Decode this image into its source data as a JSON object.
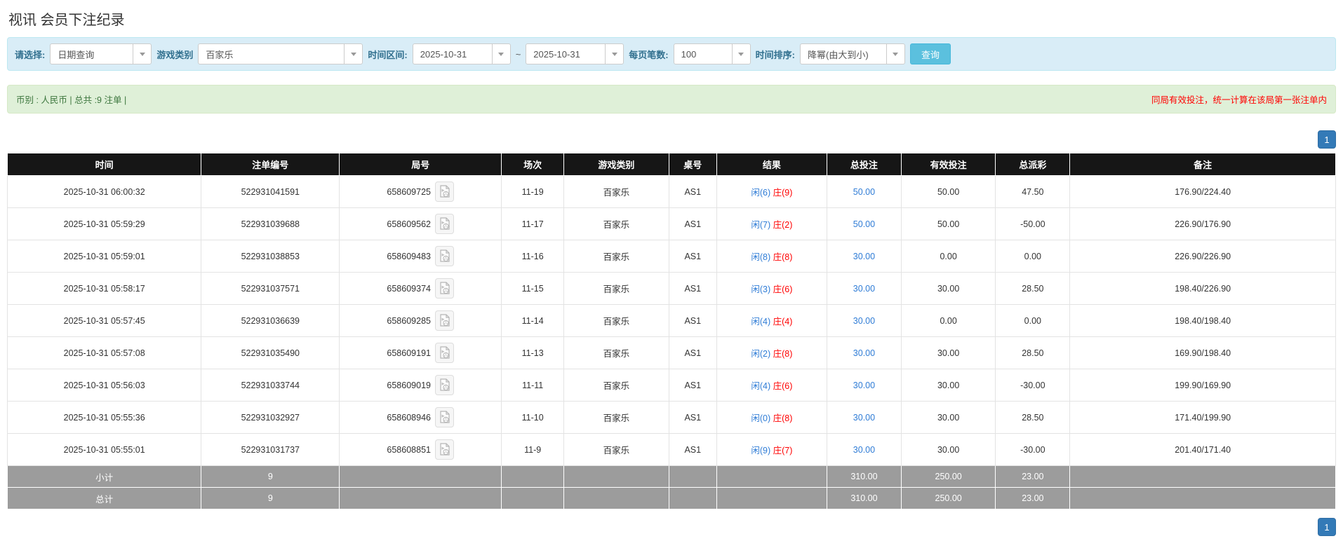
{
  "page": {
    "title": "视讯 会员下注纪录"
  },
  "colors": {
    "link_blue": "#2f7cd6",
    "banker_red": "#ff0000",
    "header_bg": "#161616",
    "summary_bg": "#9c9c9c",
    "pagination_blue": "#337ab7",
    "filter_bg": "#d9edf7",
    "info_bg": "#dff0d8",
    "search_btn": "#5bc0de"
  },
  "filters": {
    "select_label": "请选择:",
    "select_value": "日期查询",
    "game_type_label": "游戏类别",
    "game_type_value": "百家乐",
    "date_range_label": "时间区间:",
    "date_from": "2025-10-31",
    "date_separator": "~",
    "date_to": "2025-10-31",
    "page_size_label": "每页笔数:",
    "page_size_value": "100",
    "sort_label": "时间排序:",
    "sort_value": "降幂(由大到小)",
    "search_button": "查询"
  },
  "info_bar": {
    "left_text": "币别 : 人民币 | 总共 :9 注单 |",
    "right_notice": "同局有效投注，统一计算在该局第一张注单内"
  },
  "pagination": {
    "page": "1"
  },
  "table": {
    "columns": [
      "时间",
      "注单编号",
      "局号",
      "场次",
      "游戏类别",
      "桌号",
      "结果",
      "总投注",
      "有效投注",
      "总派彩",
      "备注"
    ],
    "rows": [
      {
        "time": "2025-10-31 06:00:32",
        "bet_id": "522931041591",
        "round_id": "658609725",
        "session": "11-19",
        "game": "百家乐",
        "table": "AS1",
        "player": "闲(6)",
        "banker": "庄(9)",
        "total_bet": "50.00",
        "valid_bet": "50.00",
        "payout": "47.50",
        "remark": "176.90/224.40"
      },
      {
        "time": "2025-10-31 05:59:29",
        "bet_id": "522931039688",
        "round_id": "658609562",
        "session": "11-17",
        "game": "百家乐",
        "table": "AS1",
        "player": "闲(7)",
        "banker": "庄(2)",
        "total_bet": "50.00",
        "valid_bet": "50.00",
        "payout": "-50.00",
        "remark": "226.90/176.90"
      },
      {
        "time": "2025-10-31 05:59:01",
        "bet_id": "522931038853",
        "round_id": "658609483",
        "session": "11-16",
        "game": "百家乐",
        "table": "AS1",
        "player": "闲(8)",
        "banker": "庄(8)",
        "total_bet": "30.00",
        "valid_bet": "0.00",
        "payout": "0.00",
        "remark": "226.90/226.90"
      },
      {
        "time": "2025-10-31 05:58:17",
        "bet_id": "522931037571",
        "round_id": "658609374",
        "session": "11-15",
        "game": "百家乐",
        "table": "AS1",
        "player": "闲(3)",
        "banker": "庄(6)",
        "total_bet": "30.00",
        "valid_bet": "30.00",
        "payout": "28.50",
        "remark": "198.40/226.90"
      },
      {
        "time": "2025-10-31 05:57:45",
        "bet_id": "522931036639",
        "round_id": "658609285",
        "session": "11-14",
        "game": "百家乐",
        "table": "AS1",
        "player": "闲(4)",
        "banker": "庄(4)",
        "total_bet": "30.00",
        "valid_bet": "0.00",
        "payout": "0.00",
        "remark": "198.40/198.40"
      },
      {
        "time": "2025-10-31 05:57:08",
        "bet_id": "522931035490",
        "round_id": "658609191",
        "session": "11-13",
        "game": "百家乐",
        "table": "AS1",
        "player": "闲(2)",
        "banker": "庄(8)",
        "total_bet": "30.00",
        "valid_bet": "30.00",
        "payout": "28.50",
        "remark": "169.90/198.40"
      },
      {
        "time": "2025-10-31 05:56:03",
        "bet_id": "522931033744",
        "round_id": "658609019",
        "session": "11-11",
        "game": "百家乐",
        "table": "AS1",
        "player": "闲(4)",
        "banker": "庄(6)",
        "total_bet": "30.00",
        "valid_bet": "30.00",
        "payout": "-30.00",
        "remark": "199.90/169.90"
      },
      {
        "time": "2025-10-31 05:55:36",
        "bet_id": "522931032927",
        "round_id": "658608946",
        "session": "11-10",
        "game": "百家乐",
        "table": "AS1",
        "player": "闲(0)",
        "banker": "庄(8)",
        "total_bet": "30.00",
        "valid_bet": "30.00",
        "payout": "28.50",
        "remark": "171.40/199.90"
      },
      {
        "time": "2025-10-31 05:55:01",
        "bet_id": "522931031737",
        "round_id": "658608851",
        "session": "11-9",
        "game": "百家乐",
        "table": "AS1",
        "player": "闲(9)",
        "banker": "庄(7)",
        "total_bet": "30.00",
        "valid_bet": "30.00",
        "payout": "-30.00",
        "remark": "201.40/171.40"
      }
    ],
    "subtotal": {
      "label": "小计",
      "count": "9",
      "total_bet": "310.00",
      "valid_bet": "250.00",
      "payout": "23.00"
    },
    "total": {
      "label": "总计",
      "count": "9",
      "total_bet": "310.00",
      "valid_bet": "250.00",
      "payout": "23.00"
    }
  }
}
